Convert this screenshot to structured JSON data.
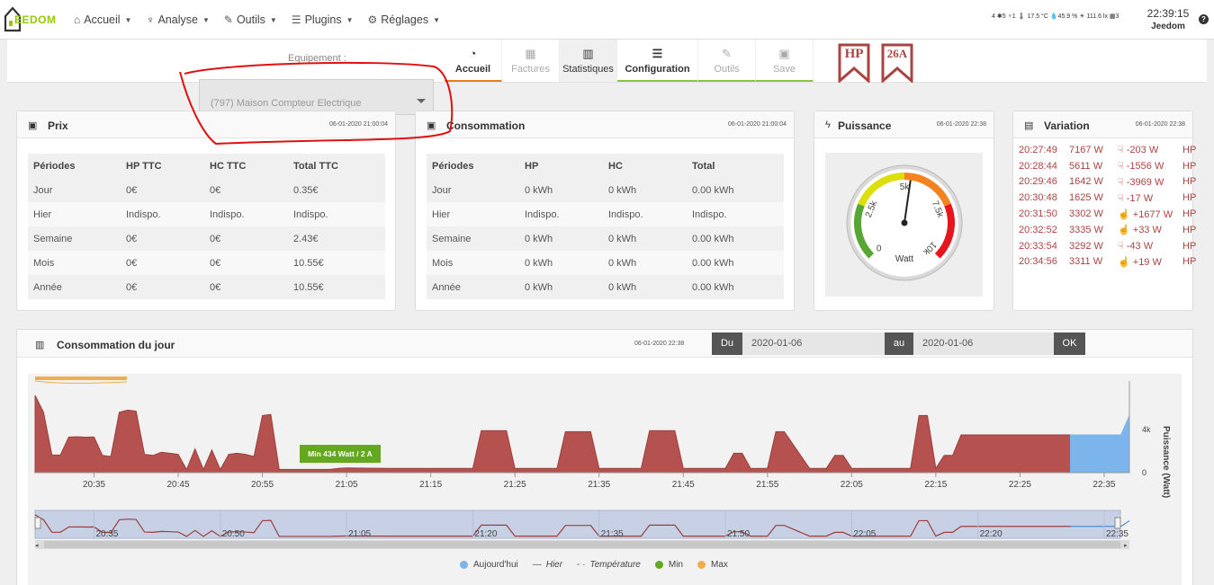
{
  "nav": {
    "logo_text": "EEDOM",
    "items": [
      {
        "label": "Accueil",
        "icon": "home-icon"
      },
      {
        "label": "Analyse",
        "icon": "stethoscope-icon"
      },
      {
        "label": "Outils",
        "icon": "wrench-icon"
      },
      {
        "label": "Plugins",
        "icon": "list-icon"
      },
      {
        "label": "Réglages",
        "icon": "gear-icon"
      }
    ],
    "status": "4 ✱5 ♆1 🌡 17.5 °C 💧45.9 % ☀ 111.6 lx ▦3",
    "clock": "22:39:15",
    "user": "Jeedom",
    "help": "?"
  },
  "equipment": {
    "label": "Equipement :",
    "selected": "(797) Maison Compteur Electrique"
  },
  "tabs": [
    {
      "label": "Accueil"
    },
    {
      "label": "Factures"
    },
    {
      "label": "Statistiques"
    },
    {
      "label": "Configuration"
    },
    {
      "label": "Outils"
    },
    {
      "label": "Save"
    }
  ],
  "badges": {
    "hp": "HP",
    "amp": "26A"
  },
  "prix": {
    "title": "Prix",
    "date": "06-01-2020 21:00:04",
    "headers": [
      "Périodes",
      "HP TTC",
      "HC TTC",
      "Total TTC"
    ],
    "rows": [
      [
        "Jour",
        "0€",
        "0€",
        "0.35€"
      ],
      [
        "Hier",
        "Indispo.",
        "Indispo.",
        "Indispo."
      ],
      [
        "Semaine",
        "0€",
        "0€",
        "2.43€"
      ],
      [
        "Mois",
        "0€",
        "0€",
        "10.55€"
      ],
      [
        "Année",
        "0€",
        "0€",
        "10.55€"
      ]
    ]
  },
  "consommation": {
    "title": "Consommation",
    "date": "06-01-2020 21:00:04",
    "headers": [
      "Périodes",
      "HP",
      "HC",
      "Total"
    ],
    "rows": [
      [
        "Jour",
        "0 kWh",
        "0 kWh",
        "0.00 kWh"
      ],
      [
        "Hier",
        "Indispo.",
        "Indispo.",
        "Indispo."
      ],
      [
        "Semaine",
        "0 kWh",
        "0 kWh",
        "0.00 kWh"
      ],
      [
        "Mois",
        "0 kWh",
        "0 kWh",
        "0.00 kWh"
      ],
      [
        "Année",
        "0 kWh",
        "0 kWh",
        "0.00 kWh"
      ]
    ]
  },
  "puissance": {
    "title": "Puissance",
    "date": "06-01-2020 22:38",
    "gauge": {
      "min_label": "0",
      "ticks": [
        "2.5k",
        "5k",
        "7.5k",
        "10k"
      ],
      "unit": "Watt",
      "value": 5300,
      "max": 10000
    }
  },
  "variation": {
    "title": "Variation",
    "date": "06-01-2020 22:38",
    "rows": [
      {
        "time": "20:27:49",
        "watt": "7167 W",
        "delta": "-203 W",
        "tarif": "HP",
        "dir": "down"
      },
      {
        "time": "20:28:44",
        "watt": "5611 W",
        "delta": "-1556 W",
        "tarif": "HP",
        "dir": "down"
      },
      {
        "time": "20:29:46",
        "watt": "1642 W",
        "delta": "-3969 W",
        "tarif": "HP",
        "dir": "down"
      },
      {
        "time": "20:30:48",
        "watt": "1625 W",
        "delta": "-17 W",
        "tarif": "HP",
        "dir": "down"
      },
      {
        "time": "20:31:50",
        "watt": "3302 W",
        "delta": "+1677 W",
        "tarif": "HP",
        "dir": "up"
      },
      {
        "time": "20:32:52",
        "watt": "3335 W",
        "delta": "+33 W",
        "tarif": "HP",
        "dir": "up"
      },
      {
        "time": "20:33:54",
        "watt": "3292 W",
        "delta": "-43 W",
        "tarif": "HP",
        "dir": "down"
      },
      {
        "time": "20:34:56",
        "watt": "3311 W",
        "delta": "+19 W",
        "tarif": "HP",
        "dir": "up"
      }
    ]
  },
  "day": {
    "title": "Consommation du jour",
    "date": "06-01-2020 22:38",
    "du_label": "Du",
    "du_value": "2020-01-06",
    "au_label": "au",
    "au_value": "2020-01-06",
    "ok_label": "OK",
    "tooltip": "Min 434 Watt / 2 A",
    "legend": [
      {
        "label": "Aujourd'hui",
        "color": "#7cb5ec",
        "kind": "dot"
      },
      {
        "label": "Hier",
        "kind": "line"
      },
      {
        "label": "Température",
        "kind": "dashdot"
      },
      {
        "label": "Min",
        "color": "#63a91f",
        "kind": "dot"
      },
      {
        "label": "Max",
        "color": "#f0ad4e",
        "kind": "dot"
      }
    ]
  },
  "chart_data": {
    "type": "area",
    "title": "",
    "xlabel": "",
    "ylabel": "Puissance (Watt)",
    "x_ticks": [
      "20:35",
      "20:45",
      "20:55",
      "21:05",
      "21:15",
      "21:25",
      "21:35",
      "21:45",
      "21:55",
      "22:05",
      "22:15",
      "22:25",
      "22:35"
    ],
    "y_ticks": [
      "0",
      "4k"
    ],
    "ylim": [
      0,
      8000
    ],
    "navigator_ticks": [
      "20:35",
      "20:50",
      "21:05",
      "21:20",
      "21:35",
      "21:50",
      "22:05",
      "22:20",
      "22:35"
    ],
    "series": [
      {
        "name": "Hier",
        "color": "#b5524f",
        "x": [
          "20:28",
          "20:29",
          "20:30",
          "20:31",
          "20:32",
          "20:33",
          "20:34",
          "20:35",
          "20:36",
          "20:37",
          "20:38",
          "20:39",
          "20:40",
          "20:41",
          "20:42",
          "20:43",
          "20:44",
          "20:45",
          "20:46",
          "20:47",
          "20:48",
          "20:49",
          "20:50",
          "20:51",
          "20:52",
          "20:53",
          "20:54",
          "20:55",
          "20:56",
          "20:57",
          "20:58",
          "20:59",
          "21:00",
          "21:01",
          "21:02",
          "21:03",
          "21:04",
          "21:05",
          "21:10",
          "21:15",
          "21:20",
          "21:21",
          "21:22",
          "21:23",
          "21:24",
          "21:25",
          "21:30",
          "21:31",
          "21:32",
          "21:33",
          "21:34",
          "21:35",
          "21:36",
          "21:37",
          "21:40",
          "21:41",
          "21:42",
          "21:43",
          "21:44",
          "21:45",
          "21:46",
          "21:50",
          "21:51",
          "21:52",
          "21:53",
          "21:54",
          "21:55",
          "21:56",
          "21:57",
          "22:00",
          "22:01",
          "22:02",
          "22:03",
          "22:04",
          "22:05",
          "22:10",
          "22:11",
          "22:12",
          "22:13",
          "22:14",
          "22:15",
          "22:16",
          "22:17",
          "22:18",
          "22:19",
          "22:20",
          "22:25",
          "22:30",
          "22:31"
        ],
        "values": [
          7167,
          5611,
          1642,
          1625,
          3302,
          3335,
          3292,
          3311,
          1600,
          1500,
          5600,
          5800,
          5700,
          1700,
          1600,
          1900,
          1800,
          1700,
          300,
          2200,
          300,
          2100,
          300,
          1700,
          1800,
          1700,
          1500,
          5300,
          5400,
          300,
          300,
          300,
          300,
          300,
          300,
          300,
          400,
          434,
          400,
          400,
          400,
          3900,
          3900,
          3900,
          3900,
          400,
          400,
          3800,
          3800,
          3800,
          3800,
          400,
          400,
          400,
          400,
          3900,
          3900,
          3900,
          3900,
          400,
          400,
          400,
          1800,
          1800,
          400,
          400,
          400,
          3800,
          3800,
          400,
          400,
          400,
          1600,
          1600,
          400,
          400,
          400,
          400,
          5300,
          5300,
          400,
          1600,
          1600,
          3500,
          3500,
          3500,
          3500,
          3500,
          3500
        ]
      },
      {
        "name": "Aujourd'hui",
        "color": "#7cb5ec",
        "x": [
          "22:31",
          "22:35",
          "22:37",
          "22:38"
        ],
        "values": [
          3500,
          3500,
          3500,
          5300
        ]
      }
    ]
  }
}
